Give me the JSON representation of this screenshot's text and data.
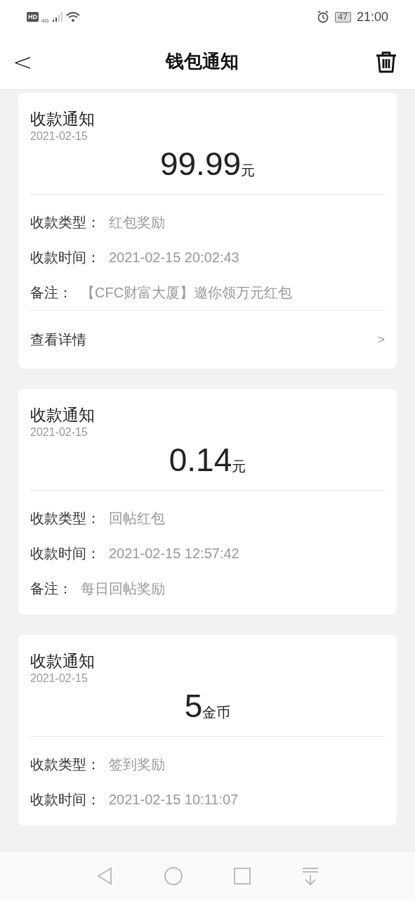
{
  "status_bar": {
    "hd": "HD",
    "network": "4G",
    "battery": "47",
    "time": "21:00"
  },
  "header": {
    "back": "<",
    "title": "钱包通知"
  },
  "cards": [
    {
      "title": "收款通知",
      "date": "2021-02-15",
      "amount": "99.99",
      "unit": "元",
      "fields": [
        {
          "label": "收款类型：",
          "value": "红包奖励"
        },
        {
          "label": "收款时间：",
          "value": "2021-02-15 20:02:43"
        },
        {
          "label": "备注：",
          "value": "【CFC财富大厦】邀你领万元红包"
        }
      ],
      "link": {
        "label": "查看详情",
        "chevron": ">"
      }
    },
    {
      "title": "收款通知",
      "date": "2021-02-15",
      "amount": "0.14",
      "unit": "元",
      "fields": [
        {
          "label": "收款类型：",
          "value": "回帖红包"
        },
        {
          "label": "收款时间：",
          "value": "2021-02-15 12:57:42"
        },
        {
          "label": "备注：",
          "value": "每日回帖奖励"
        }
      ]
    },
    {
      "title": "收款通知",
      "date": "2021-02-15",
      "amount": "5",
      "unit": "金币",
      "fields": [
        {
          "label": "收款类型：",
          "value": "签到奖励"
        },
        {
          "label": "收款时间：",
          "value": "2021-02-15 10:11:07"
        }
      ]
    }
  ]
}
